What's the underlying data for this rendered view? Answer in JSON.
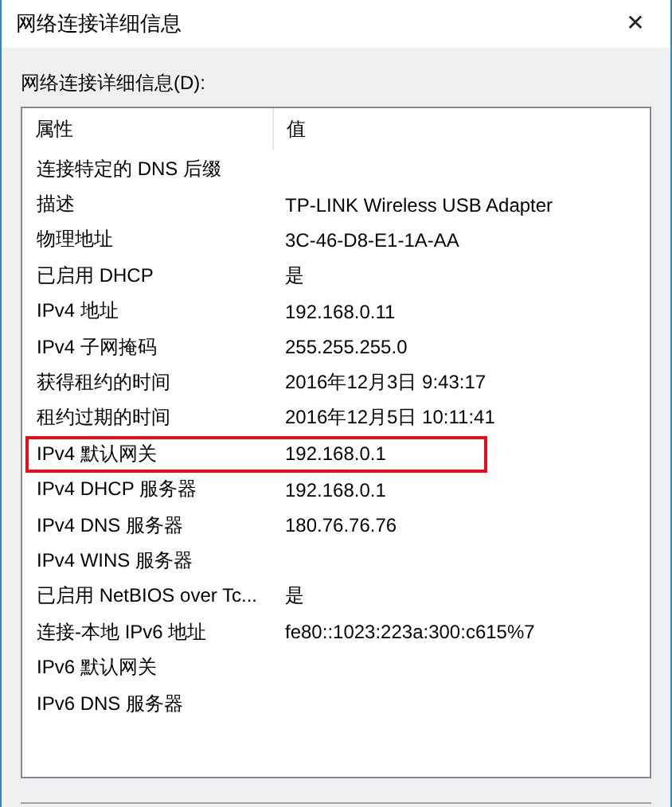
{
  "window": {
    "title": "网络连接详细信息",
    "close": "✕"
  },
  "list_label": "网络连接详细信息(D):",
  "table": {
    "columns": [
      "属性",
      "值"
    ],
    "rows": [
      {
        "property": "连接特定的 DNS 后缀",
        "highlighted": false
      },
      {
        "property": "描述",
        "value": "TP-LINK Wireless USB Adapter",
        "highlighted": false
      },
      {
        "property": "物理地址",
        "value": "3C-46-D8-E1-1A-AA",
        "highlighted": false
      },
      {
        "property": "已启用 DHCP",
        "value": "是",
        "highlighted": false
      },
      {
        "property": "IPv4 地址",
        "value": "192.168.0.11",
        "highlighted": false
      },
      {
        "property": "IPv4 子网掩码",
        "value": "255.255.255.0",
        "highlighted": false
      },
      {
        "property": "获得租约的时间",
        "value": "2016年12月3日 9:43:17",
        "highlighted": false
      },
      {
        "property": "租约过期的时间",
        "value": "2016年12月5日 10:11:41",
        "highlighted": false
      },
      {
        "property": "IPv4 默认网关",
        "value": "192.168.0.1",
        "highlighted": true
      },
      {
        "property": "IPv4 DHCP 服务器",
        "value": "192.168.0.1",
        "highlighted": false
      },
      {
        "property": "IPv4 DNS 服务器",
        "value": "180.76.76.76",
        "highlighted": false
      },
      {
        "property": "IPv4 WINS 服务器",
        "highlighted": false
      },
      {
        "property": "已启用 NetBIOS over Tc...",
        "value": "是",
        "highlighted": false
      },
      {
        "property": "连接-本地 IPv6 地址",
        "value": "fe80::1023:223a:300:c615%7",
        "highlighted": false
      },
      {
        "property": "IPv6 默认网关",
        "highlighted": false
      },
      {
        "property": "IPv6 DNS 服务器",
        "highlighted": false
      }
    ]
  }
}
